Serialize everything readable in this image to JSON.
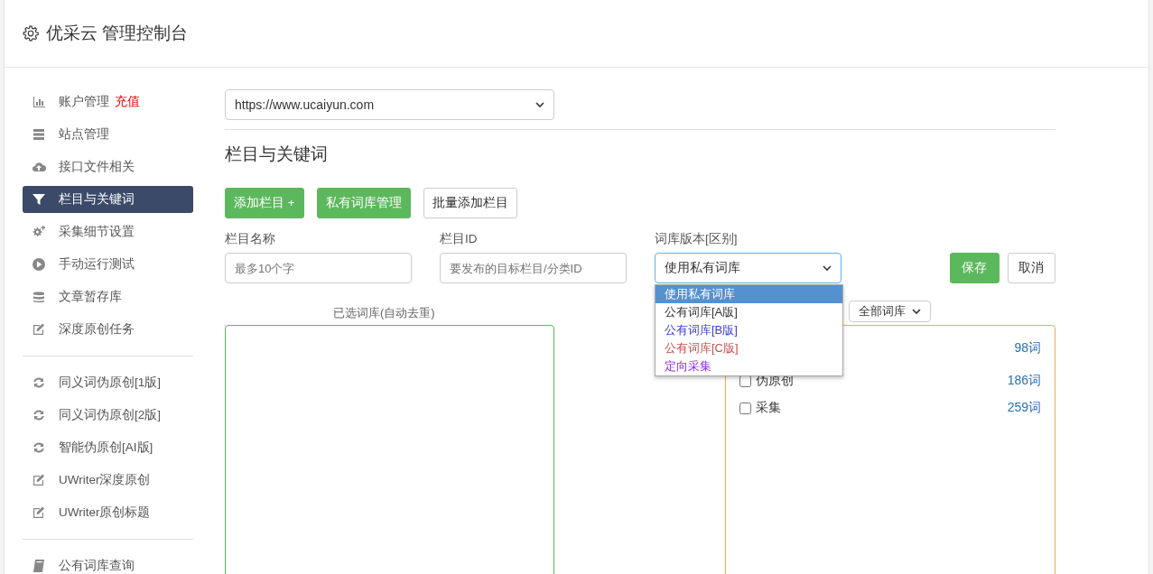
{
  "header": {
    "title": "优采云 管理控制台"
  },
  "sidebar": {
    "groups": [
      [
        {
          "label": "账户管理",
          "badge": "充值",
          "selected": false
        },
        {
          "label": "站点管理",
          "selected": false
        },
        {
          "label": "接口文件相关",
          "selected": false
        },
        {
          "label": "栏目与关键词",
          "selected": true
        },
        {
          "label": "采集细节设置",
          "selected": false
        },
        {
          "label": "手动运行测试",
          "selected": false
        },
        {
          "label": "文章暂存库",
          "selected": false
        },
        {
          "label": "深度原创任务",
          "selected": false
        }
      ],
      [
        {
          "label": "同义词伪原创[1版]",
          "selected": false
        },
        {
          "label": "同义词伪原创[2版]",
          "selected": false
        },
        {
          "label": "智能伪原创[AI版]",
          "selected": false
        },
        {
          "label": "UWriter深度原创",
          "selected": false
        },
        {
          "label": "UWriter原创标题",
          "selected": false
        }
      ],
      [
        {
          "label": "公有词库查询",
          "selected": false
        }
      ]
    ]
  },
  "site_select": {
    "value": "https://www.ucaiyun.com"
  },
  "section_title": "栏目与关键词",
  "toolbar": [
    {
      "label": "添加栏目 +",
      "kind": "primary"
    },
    {
      "label": "私有词库管理",
      "kind": "primary"
    },
    {
      "label": "批量添加栏目",
      "kind": "default"
    }
  ],
  "form": {
    "name_label": "栏目名称",
    "name_placeholder": "最多10个字",
    "id_label": "栏目ID",
    "id_placeholder": "要发布的目标栏目/分类ID",
    "version_label": "词库版本[区别]",
    "version_value": "使用私有词库",
    "save": "保存",
    "cancel": "取消",
    "version_options": [
      {
        "label": "使用私有词库",
        "selected": true
      },
      {
        "label": "公有词库[A版]",
        "selected": false,
        "color": "#333333"
      },
      {
        "label": "公有词库[B版]",
        "selected": false,
        "color": "#3b3bd9"
      },
      {
        "label": "公有词库[C版]",
        "selected": false,
        "color": "#c0504d"
      },
      {
        "label": "定向采集",
        "selected": false,
        "color": "#8a2be2"
      }
    ]
  },
  "selected_label": "已选词库(自动去重)",
  "library_filter": {
    "value": "全部词库"
  },
  "libraries": [
    {
      "count": "98词"
    },
    {
      "label": "伪原创",
      "count": "186词",
      "checked": false
    },
    {
      "label": "采集",
      "count": "259词",
      "checked": false
    }
  ]
}
